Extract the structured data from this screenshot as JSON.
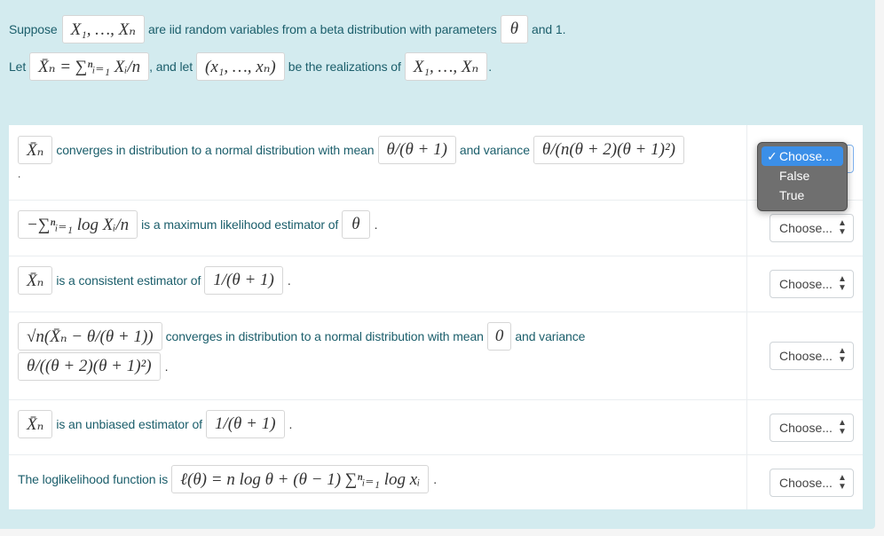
{
  "intro": {
    "line1": {
      "t1": "Suppose",
      "m1": "X₁, …, Xₙ",
      "t2": "are iid random variables from a beta distribution with parameters",
      "m2": "θ",
      "t3": "and 1."
    },
    "line2": {
      "t1": "Let",
      "m1": "X̄ₙ = ∑ⁿᵢ₌₁ Xᵢ/n",
      "t2": ", and let",
      "m2": "(x₁, …, xₙ)",
      "t3": "be the realizations of",
      "m3": "X₁, …, Xₙ",
      "t4": "."
    }
  },
  "questions": [
    {
      "m1": "X̄ₙ",
      "t1": "converges in distribution to a normal distribution with mean",
      "m2": "θ/(θ + 1)",
      "t2": "and variance",
      "m3": "θ/(n(θ + 2)(θ + 1)²)",
      "t3": ".",
      "select": "Choose..."
    },
    {
      "m1": "−∑ⁿᵢ₌₁ log Xᵢ/n",
      "t1": "is a maximum likelihood estimator of",
      "m2": "θ",
      "t2": ".",
      "select": "Choose..."
    },
    {
      "m1": "X̄ₙ",
      "t1": "is a consistent estimator of",
      "m2": "1/(θ + 1)",
      "t2": ".",
      "select": "Choose..."
    },
    {
      "m1": "√n(X̄ₙ − θ/(θ + 1))",
      "t1": "converges in distribution to a normal distribution with mean",
      "m2": "0",
      "t2": "and variance",
      "m3": "θ/((θ + 2)(θ + 1)²)",
      "t3": ".",
      "select": "Choose..."
    },
    {
      "m1": "X̄ₙ",
      "t1": "is an unbiased estimator of",
      "m2": "1/(θ + 1)",
      "t2": ".",
      "select": "Choose..."
    },
    {
      "t1": "The loglikelihood function is",
      "m1": "ℓ(θ) = n log θ + (θ − 1) ∑ⁿᵢ₌₁ log xᵢ",
      "t2": ".",
      "select": "Choose..."
    }
  ],
  "dropdown": {
    "check": "✓",
    "options": [
      "Choose...",
      "False",
      "True"
    ],
    "selected": "Choose..."
  },
  "icons": {
    "select_arrows": "updown-arrows-icon"
  },
  "colors": {
    "panel_bg": "#d3ebef",
    "text": "#1b5e6b",
    "dropdown_bg": "#6f6f6f",
    "dropdown_selected": "#3b8fe8"
  }
}
